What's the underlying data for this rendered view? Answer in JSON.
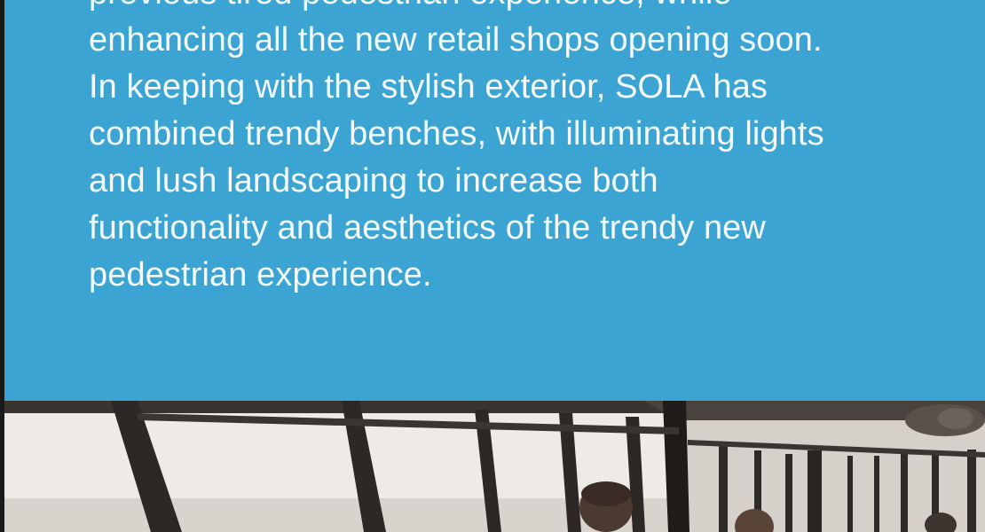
{
  "article": {
    "lines": [
      "previous tired pedestrian experience, while",
      "enhancing all the new retail shops opening soon.",
      "In keeping with the stylish exterior, SOLA has",
      "combined trendy benches, with illuminating lights",
      "and lush landscaping to increase both",
      "functionality and aesthetics of the trendy new",
      "pedestrian experience."
    ]
  },
  "photo": {
    "subject": "restaurant-interior-with-window-view"
  },
  "colors": {
    "panel": "#3ba4d2",
    "text": "#f4fbff"
  }
}
